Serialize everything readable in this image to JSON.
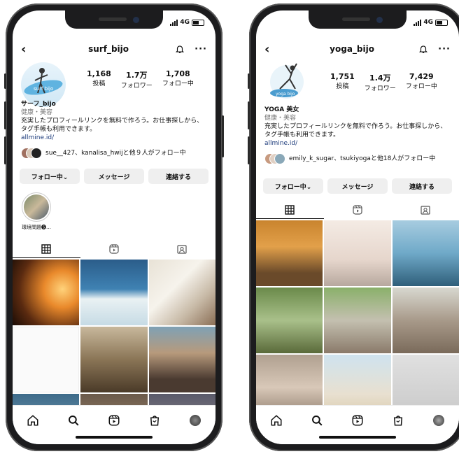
{
  "status": {
    "network": "4G"
  },
  "phones": [
    {
      "username": "surf_bijo",
      "stats": [
        {
          "value": "1,168",
          "label": "投稿"
        },
        {
          "value": "1.7万",
          "label": "フォロワー"
        },
        {
          "value": "1,708",
          "label": "フォロー中"
        }
      ],
      "avatar_text": "surf bijo",
      "bio": {
        "name": "サーフ_bijo",
        "category": "健康・美容",
        "text": "充実したプロフィールリンクを無料で作ろう。お仕事探しから、タグ手帳も利用できます。",
        "link": "allmine.id/"
      },
      "followed_by": "sue__427、kanalisa_hwijと他９人がフォロー中",
      "actions": [
        "フォロー中⌄",
        "メッセージ",
        "連絡する"
      ],
      "highlight_label": "環境問題🅢…"
    },
    {
      "username": "yoga_bijo",
      "stats": [
        {
          "value": "1,751",
          "label": "投稿"
        },
        {
          "value": "1.4万",
          "label": "フォロワー"
        },
        {
          "value": "7,429",
          "label": "フォロー中"
        }
      ],
      "avatar_text": "yoga bijo",
      "bio": {
        "name": "YOGA 美女",
        "category": "健康・美容",
        "text": "充実したプロフィールリンクを無料で作ろう。お仕事探しから、タグ手帳も利用できます。",
        "link": "allmine.id/"
      },
      "followed_by": "emily_k_sugar、tsukiyogaと他18人がフォロー中",
      "actions": [
        "フォロー中⌄",
        "メッセージ",
        "連絡する"
      ]
    }
  ],
  "icons": {
    "back": "chevron-left-icon",
    "bell": "bell-icon",
    "more": "more-icon",
    "grid": "grid-icon",
    "reels": "reels-icon",
    "tagged": "tagged-icon",
    "home": "home-icon",
    "search": "search-icon",
    "shop": "shop-icon",
    "profile": "profile-icon"
  },
  "colors": {
    "link": "#1b3a7a",
    "button_bg": "#efefef",
    "frame": "#1c1c1e"
  }
}
